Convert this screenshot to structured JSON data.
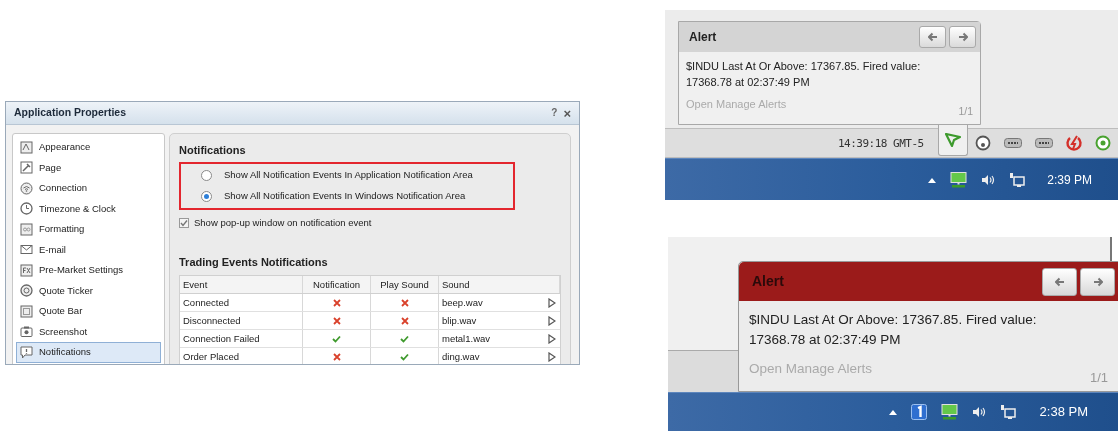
{
  "dialog": {
    "title": "Application Properties",
    "help_glyph": "?",
    "close_glyph": "×",
    "sidebar": {
      "items": [
        {
          "label": "Appearance",
          "selected": false
        },
        {
          "label": "Page",
          "selected": false
        },
        {
          "label": "Connection",
          "selected": false
        },
        {
          "label": "Timezone & Clock",
          "selected": false
        },
        {
          "label": "Formatting",
          "selected": false
        },
        {
          "label": "E-mail",
          "selected": false
        },
        {
          "label": "Pre-Market Settings",
          "selected": false
        },
        {
          "label": "Quote Ticker",
          "selected": false
        },
        {
          "label": "Quote Bar",
          "selected": false
        },
        {
          "label": "Screenshot",
          "selected": false
        },
        {
          "label": "Notifications",
          "selected": true
        }
      ]
    },
    "notifications": {
      "heading": "Notifications",
      "radios": [
        {
          "label": "Show All Notification Events In Application Notification Area",
          "selected": false
        },
        {
          "label": "Show All Notification Events In Windows Notification Area",
          "selected": true
        }
      ],
      "popup_checkbox": {
        "label": "Show pop-up window on notification event",
        "checked": true
      }
    },
    "trading": {
      "heading": "Trading Events Notifications",
      "columns": [
        "Event",
        "Notification",
        "Play Sound",
        "Sound"
      ],
      "rows": [
        {
          "event": "Connected",
          "notification": false,
          "play_sound": false,
          "sound": "beep.wav"
        },
        {
          "event": "Disconnected",
          "notification": false,
          "play_sound": false,
          "sound": "blip.wav"
        },
        {
          "event": "Connection Failed",
          "notification": true,
          "play_sound": true,
          "sound": "metal1.wav"
        },
        {
          "event": "Order Placed",
          "notification": false,
          "play_sound": true,
          "sound": "ding.wav"
        }
      ]
    }
  },
  "alerts": [
    {
      "kind": "normal",
      "title": "Alert",
      "message": "$INDU Last At Or Above: 17367.85. Fired value: 17368.78 at 02:37:49 PM",
      "link": "Open Manage Alerts",
      "counter": "1/1",
      "status_clock": "14:39:18 GMT-5",
      "taskbar_clock": "2:39 PM"
    },
    {
      "kind": "urgent",
      "title": "Alert",
      "message": "$INDU Last At Or Above: 17367.85. Fired value: 17368.78 at 02:37:49 PM",
      "link": "Open Manage Alerts",
      "counter": "1/1",
      "taskbar_clock": "2:38 PM"
    }
  ]
}
